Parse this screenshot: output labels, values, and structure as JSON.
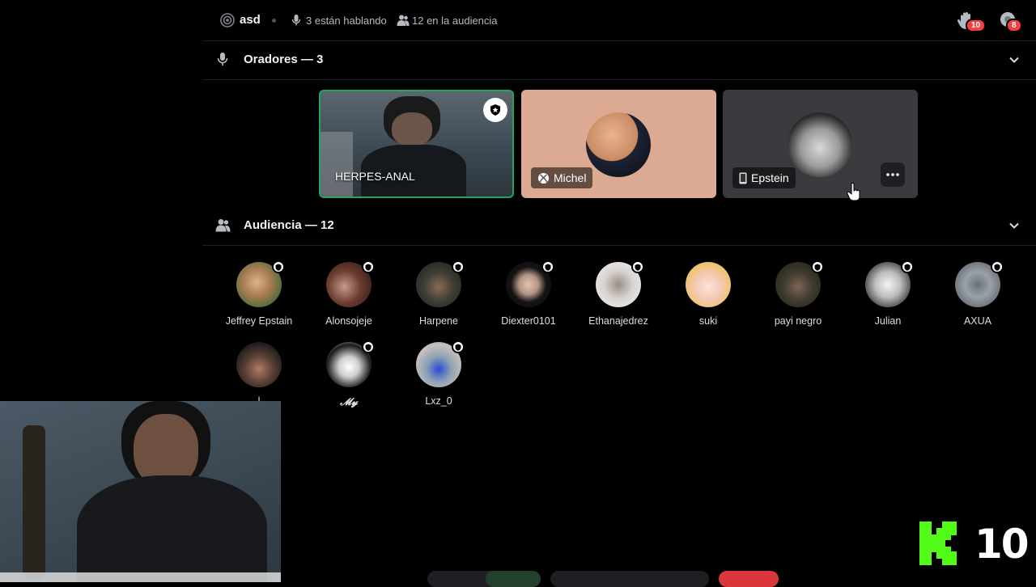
{
  "topbar": {
    "title": "asd",
    "speaking": "3 están hablando",
    "audience": "12 en la audiencia",
    "hands_badge": "10",
    "requests_badge": "8"
  },
  "speakers": {
    "header": "Oradores — 3",
    "tiles": [
      {
        "label": "HERPES-ANAL"
      },
      {
        "label": "Michel"
      },
      {
        "label": "Epstein"
      }
    ]
  },
  "audience": {
    "header": "Audiencia — 12",
    "members": [
      {
        "name": "Jeffrey Epstain"
      },
      {
        "name": "Alonsojeje"
      },
      {
        "name": "Harpene"
      },
      {
        "name": "Diexter0101"
      },
      {
        "name": "Ethanajedrez"
      },
      {
        "name": "suki"
      },
      {
        "name": "payi negro"
      },
      {
        "name": "Julian"
      },
      {
        "name": "AXUA"
      },
      {
        "name": "l"
      },
      {
        "name": "𝓜𝔂"
      },
      {
        "name": "Lxz_0"
      }
    ]
  },
  "overlay": {
    "counter": "10"
  },
  "colors": {
    "accent_green": "#23a55a",
    "badge_red": "#f23f43",
    "logo_green": "#53fc18"
  }
}
